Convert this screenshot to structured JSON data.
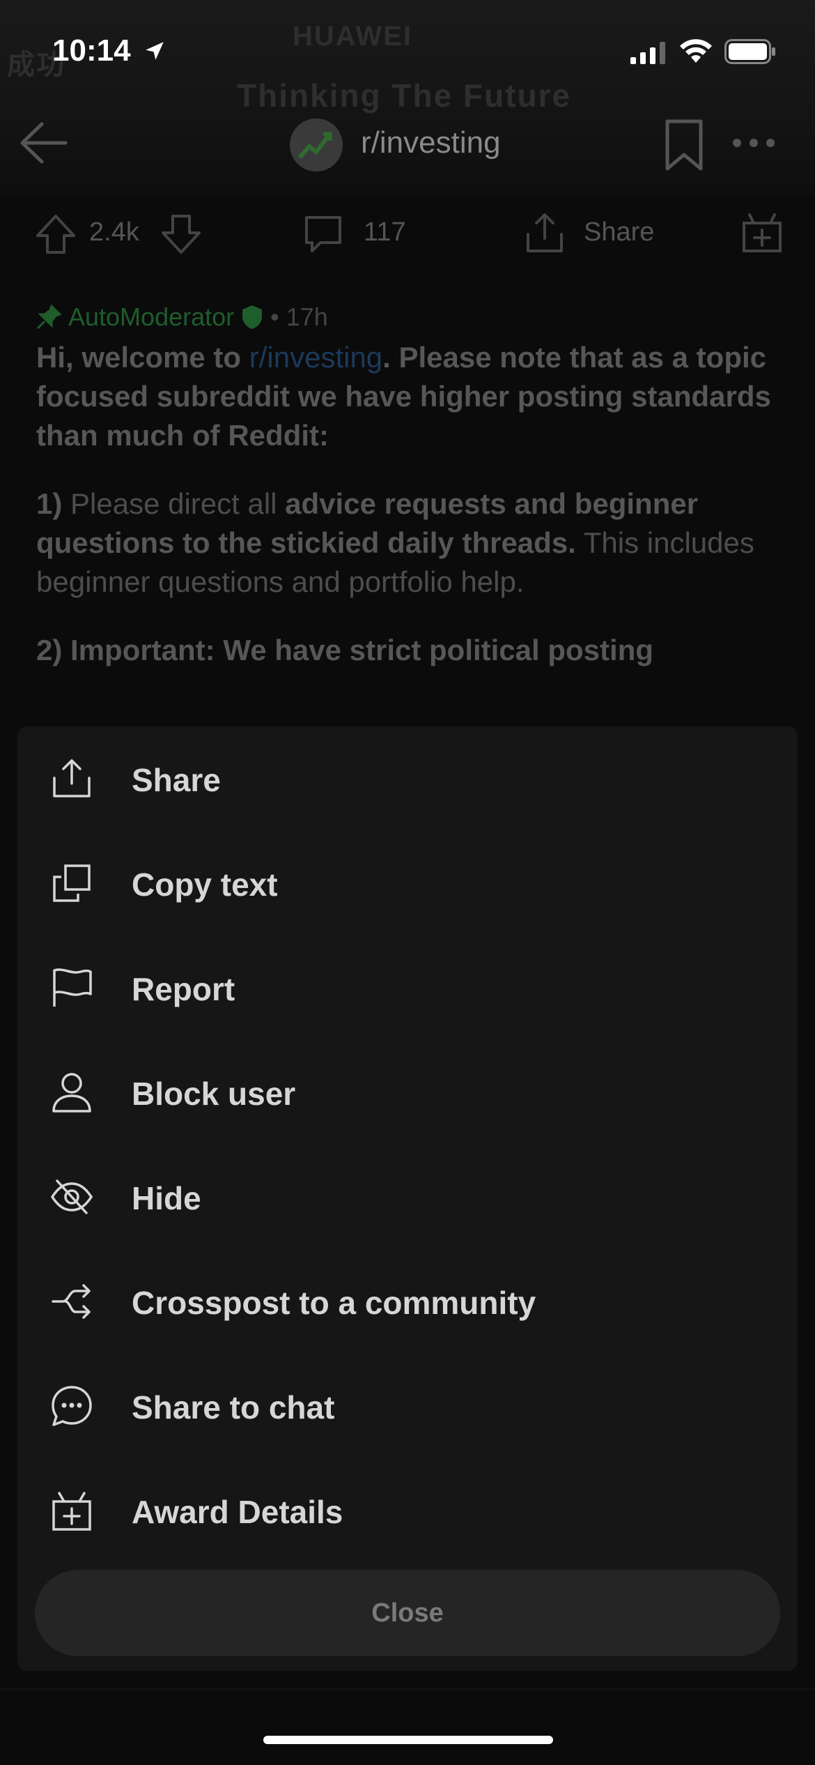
{
  "status_bar": {
    "time": "10:14",
    "icons": [
      "location-arrow-icon",
      "cellular-signal-icon",
      "wifi-icon",
      "battery-icon"
    ]
  },
  "banner": {
    "texts": [
      "HUAWEI",
      "Thinking The Future",
      "成功"
    ]
  },
  "nav": {
    "subreddit": "r/investing",
    "icons": [
      "back-arrow-icon",
      "bookmark-icon",
      "more-icon"
    ]
  },
  "actions": {
    "votes": "2.4k",
    "comments": "117",
    "share_label": "Share"
  },
  "post": {
    "author": "AutoModerator",
    "time_ago": "• 17h",
    "para1_a": "Hi, welcome to ",
    "para1_link": "r/investing",
    "para1_b": ". Please note that as a topic focused subreddit we have higher posting standards than much of Reddit:",
    "para2_num": "1)",
    "para2_a": " Please direct all ",
    "para2_bold": "advice requests and beginner questions to the stickied daily threads.",
    "para2_b": " This includes beginner questions and portfolio help.",
    "para3": "2) Important: We have strict political posting"
  },
  "menu": {
    "items": [
      {
        "label": "Share",
        "icon": "share-icon"
      },
      {
        "label": "Copy text",
        "icon": "copy-icon"
      },
      {
        "label": "Report",
        "icon": "flag-icon"
      },
      {
        "label": "Block user",
        "icon": "user-icon"
      },
      {
        "label": "Hide",
        "icon": "eye-off-icon"
      },
      {
        "label": "Crosspost to a community",
        "icon": "crosspost-icon"
      },
      {
        "label": "Share to chat",
        "icon": "chat-icon"
      },
      {
        "label": "Award Details",
        "icon": "gift-icon"
      }
    ],
    "close_label": "Close"
  },
  "colors": {
    "sheet_bg": "#161616",
    "close_bg": "#252525",
    "mod_green": "#1f5d2c",
    "link_blue": "#1b3a5c"
  }
}
